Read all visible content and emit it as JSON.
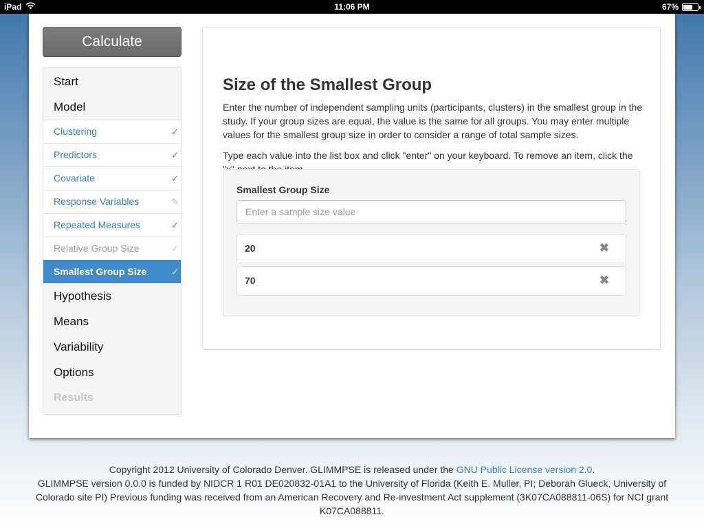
{
  "status_bar": {
    "device": "iPad",
    "time": "11:06 PM",
    "battery": "67%",
    "battery_level": 0.67,
    "wifi_icon": "wifi-icon",
    "battery_icon": "battery-icon"
  },
  "calculate_button": "Calculate",
  "nav": {
    "items": [
      {
        "label": "Start",
        "kind": "heading"
      },
      {
        "label": "Model",
        "kind": "heading"
      },
      {
        "label": "Clustering",
        "kind": "sub",
        "status": "✓",
        "status_icon": "check-icon"
      },
      {
        "label": "Predictors",
        "kind": "sub",
        "status": "✓",
        "status_icon": "check-icon"
      },
      {
        "label": "Covariate",
        "kind": "sub",
        "status": "✓",
        "status_icon": "check-icon"
      },
      {
        "label": "Response Variables",
        "kind": "sub",
        "status": "✎",
        "status_icon": "pencil-icon"
      },
      {
        "label": "Repeated Measures",
        "kind": "sub",
        "status": "✓",
        "status_icon": "check-icon"
      },
      {
        "label": "Relative Group Size",
        "kind": "sub",
        "status": "✓",
        "status_icon": "check-icon",
        "muted": true
      },
      {
        "label": "Smallest Group Size",
        "kind": "sub",
        "status": "✓",
        "status_icon": "check-icon",
        "active": true
      },
      {
        "label": "Hypothesis",
        "kind": "heading"
      },
      {
        "label": "Means",
        "kind": "heading"
      },
      {
        "label": "Variability",
        "kind": "heading"
      },
      {
        "label": "Options",
        "kind": "heading"
      },
      {
        "label": "Results",
        "kind": "heading",
        "disabled": true
      }
    ]
  },
  "panel": {
    "title": "Size of the Smallest Group",
    "description1": "Enter the number of independent sampling units (participants, clusters) in the smallest group in the study. If your group sizes are equal, the value is the same for all groups. You may enter multiple values for the smallest group size in order to consider a range of total sample sizes.",
    "description2": "Type each value into the list box and click \"enter\" on your keyboard. To remove an item, click the \"x\" next to the item.",
    "field_label": "Smallest Group Size",
    "input_placeholder": "Enter a sample size value",
    "input_value": "",
    "values": [
      "20",
      "70"
    ],
    "remove_glyph": "✖"
  },
  "footer": {
    "line1_prefix": "Copyright 2012 University of Colorado Denver. GLIMMPSE is released under the ",
    "license_link": "GNU Public License version 2.0",
    "line1_suffix": ".",
    "line2": "GLIMMPSE version 0.0.0 is funded by NIDCR 1 R01 DE020832-01A1 to the University of Florida (Keith E. Muller, PI; Deborah Glueck, University of Colorado site PI) Previous funding was received from an American Recovery and Re-investment Act supplement (3K07CA088811-06S) for NCI grant K07CA088811."
  },
  "colors": {
    "accent": "#428bca",
    "link": "#3a7fc1",
    "check": "#3aa63a"
  }
}
